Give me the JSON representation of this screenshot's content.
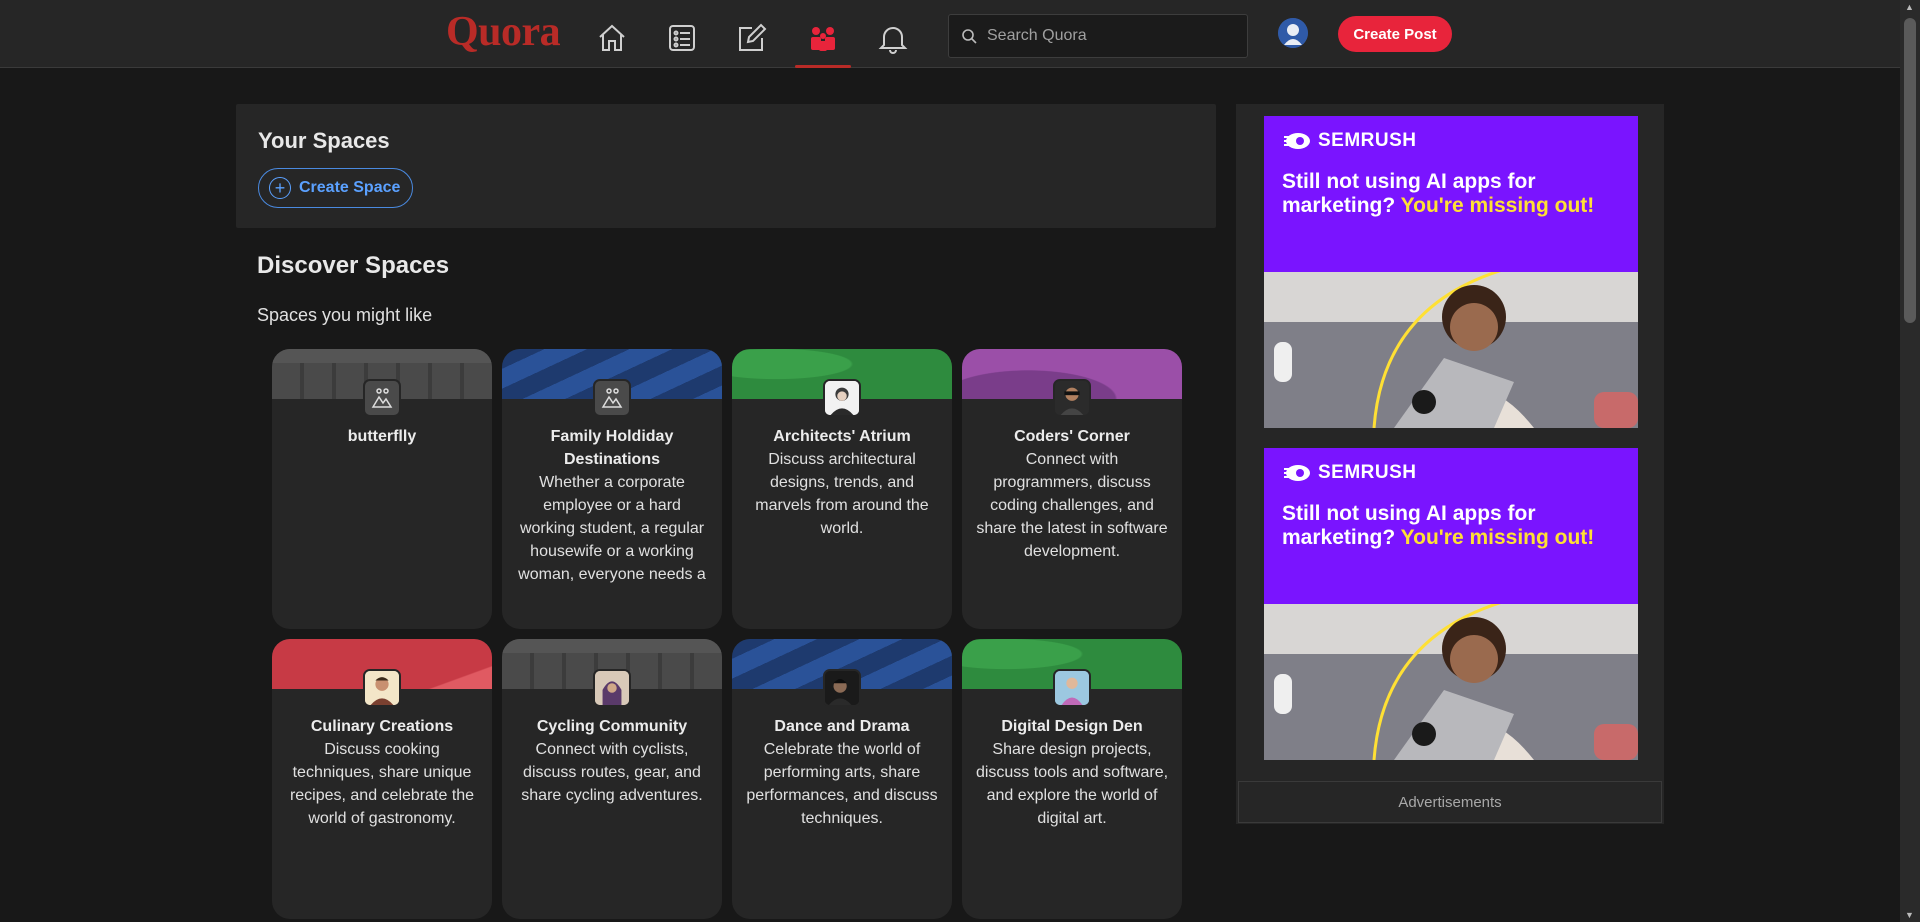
{
  "header": {
    "logo": "Quora",
    "nav": [
      {
        "name": "home-icon"
      },
      {
        "name": "following-icon"
      },
      {
        "name": "answer-icon"
      },
      {
        "name": "spaces-icon",
        "active": true
      },
      {
        "name": "notifications-icon"
      }
    ],
    "search_placeholder": "Search Quora",
    "create_post_label": "Create Post"
  },
  "your_spaces": {
    "title": "Your Spaces",
    "create_label": "Create Space"
  },
  "discover": {
    "title": "Discover Spaces",
    "subtitle": "Spaces you might like",
    "cards": [
      {
        "title": "butterflly",
        "desc": "",
        "banner": "gray",
        "icon": "default-space-icon"
      },
      {
        "title": "Family Holdiday Destinations",
        "desc": "Whether a corporate employee or a hard working student, a regular housewife or a working woman, everyone needs a break from their day to",
        "banner": "blue",
        "icon": "default-space-icon"
      },
      {
        "title": "Architects' Atrium",
        "desc": "Discuss architectural designs, trends, and marvels from around the world.",
        "banner": "green",
        "icon": "space-avatar-icon"
      },
      {
        "title": "Coders' Corner",
        "desc": "Connect with programmers, discuss coding challenges, and share the latest in software development.",
        "banner": "purple",
        "icon": "space-avatar-icon"
      },
      {
        "title": "Culinary Creations",
        "desc": "Discuss cooking techniques, share unique recipes, and celebrate the world of gastronomy.",
        "banner": "red",
        "icon": "space-avatar-icon"
      },
      {
        "title": "Cycling Community",
        "desc": "Connect with cyclists, discuss routes, gear, and share cycling adventures.",
        "banner": "gray",
        "icon": "space-avatar-icon"
      },
      {
        "title": "Dance and Drama",
        "desc": "Celebrate the world of performing arts, share performances, and discuss techniques.",
        "banner": "blue",
        "icon": "space-avatar-icon"
      },
      {
        "title": "Digital Design Den",
        "desc": "Share design projects, discuss tools and software, and explore the world of digital art.",
        "banner": "green",
        "icon": "space-avatar-icon"
      }
    ]
  },
  "ads": {
    "items": [
      {
        "brand": "SEMRUSH",
        "headline": "Still not using AI apps for marketing?",
        "highlight": "You're missing out!"
      },
      {
        "brand": "SEMRUSH",
        "headline": "Still not using AI apps for marketing?",
        "highlight": "You're missing out!"
      }
    ],
    "caption": "Advertisements"
  },
  "colors": {
    "brand_red": "#b92b27",
    "create_post_bg": "#e8243b",
    "link_blue": "#5ba1ff",
    "ad_purple": "#7a14ff",
    "ad_yellow": "#ffe034"
  }
}
